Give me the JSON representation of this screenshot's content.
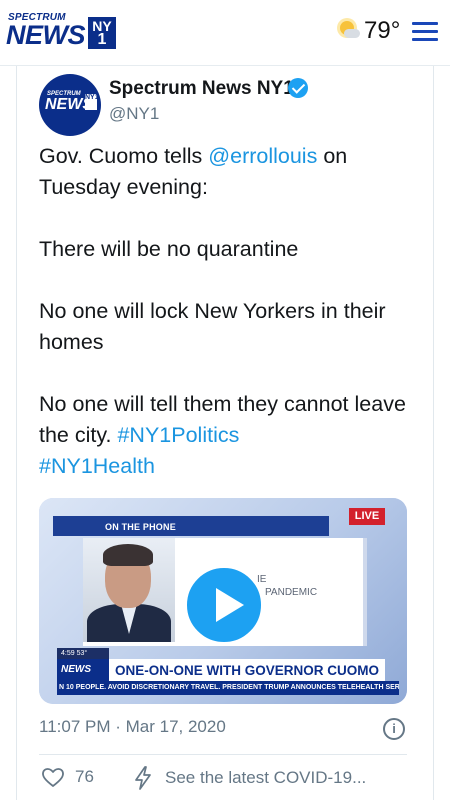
{
  "header": {
    "brand_top": "SPECTRUM",
    "brand_main": "NEWS",
    "brand_badge_line1": "NY",
    "brand_badge_line2": "1",
    "weather_icon": "partly-cloudy-sun-icon",
    "temperature": "79°",
    "menu_icon": "hamburger-menu-icon"
  },
  "tweet": {
    "avatar_text_top": "SPECTRUM",
    "avatar_text_main": "NEWS",
    "avatar_badge": "NY1",
    "author_name": "Spectrum News NY1",
    "verified_icon": "verified-badge-icon",
    "handle": "@NY1",
    "text": {
      "p1_before": "Gov. Cuomo tells ",
      "p1_mention": "@errollouis",
      "p1_after": " on Tuesday evening:",
      "p2": "There will be no quarantine",
      "p3": "No one will lock New Yorkers in their homes",
      "p4_before": "No one will tell them they cannot leave the city. ",
      "hashtag1": "#NY1Politics",
      "hashtag2": "#NY1Health"
    },
    "video": {
      "on_the_phone": "ON THE PHONE",
      "live_badge": "LIVE",
      "partial_line1": "IE",
      "partial_line2": "PANDEMIC",
      "time_weather": "4:59  53°",
      "news_tag": "NEWS",
      "headline": "ONE-ON-ONE WITH GOVERNOR CUOMO",
      "ticker": "N 10 PEOPLE. AVOID DISCRETIONARY TRAVEL.     PRESIDENT TRUMP ANNOUNCES TELEHEALTH SERV",
      "play_icon": "play-icon"
    },
    "timestamp": "11:07 PM · Mar 17, 2020",
    "info_icon": "info-icon",
    "actions": {
      "like_icon": "heart-icon",
      "like_count": "76",
      "covid_icon": "lightning-bolt-icon",
      "covid_text": "See the latest COVID-19..."
    }
  },
  "colors": {
    "brand_blue": "#0b2e8a",
    "link_blue": "#1b95e0",
    "verified_blue": "#1da1f2",
    "live_red": "#d3212c",
    "muted_gray": "#657786"
  }
}
